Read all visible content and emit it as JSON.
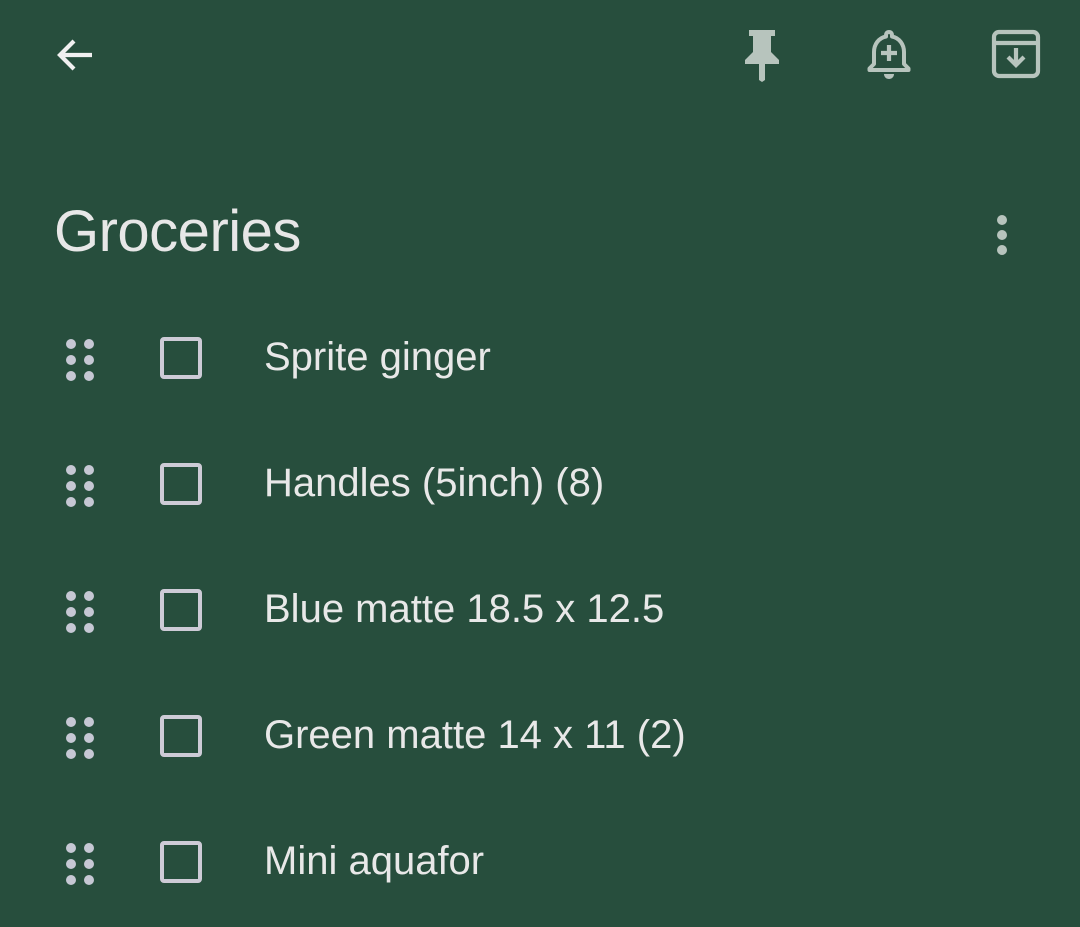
{
  "toolbar": {
    "back_icon": "arrow-back-icon",
    "pin_icon": "pin-icon",
    "reminder_icon": "add-alert-icon",
    "archive_icon": "archive-icon"
  },
  "note": {
    "title": "Groceries",
    "more_icon": "more-vert-icon"
  },
  "items": [
    {
      "text": "Sprite ginger",
      "checked": false
    },
    {
      "text": "Handles (5inch) (8)",
      "checked": false
    },
    {
      "text": "Blue matte 18.5 x 12.5",
      "checked": false
    },
    {
      "text": "Green matte 14 x 11 (2)",
      "checked": false
    },
    {
      "text": "Mini aquafor",
      "checked": false
    }
  ],
  "colors": {
    "background": "#274e3d",
    "text": "#e8e8e8",
    "icon": "#b7c4bd",
    "checkbox_border": "#cdcbd6"
  }
}
